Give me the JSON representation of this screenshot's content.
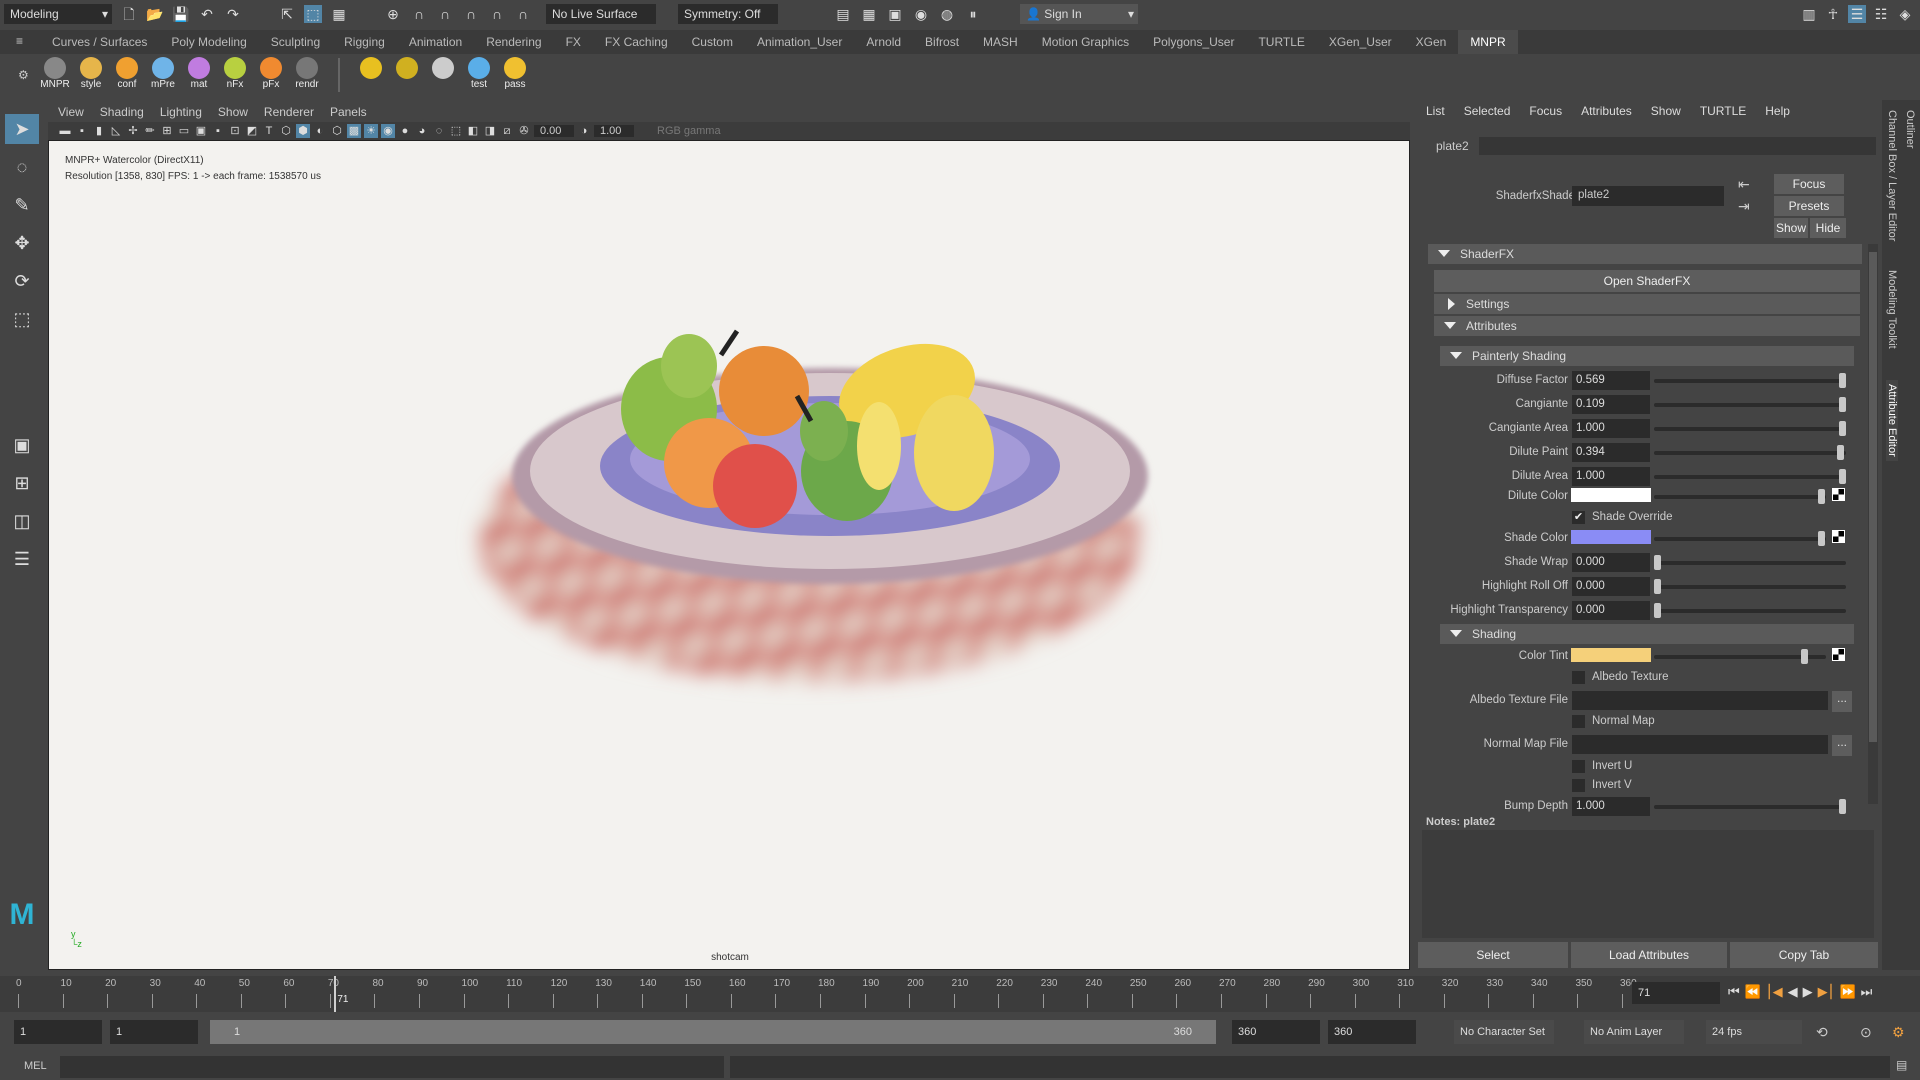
{
  "status_line": {
    "workspace": "Modeling",
    "live_surface": "No Live Surface",
    "symmetry": "Symmetry: Off",
    "sign_in": "Sign In"
  },
  "shelf_tabs": [
    "Curves / Surfaces",
    "Poly Modeling",
    "Sculpting",
    "Rigging",
    "Animation",
    "Rendering",
    "FX",
    "FX Caching",
    "Custom",
    "Animation_User",
    "Arnold",
    "Bifrost",
    "MASH",
    "Motion Graphics",
    "Polygons_User",
    "TURTLE",
    "XGen_User",
    "XGen",
    "MNPR"
  ],
  "active_shelf": "MNPR",
  "shelf_items": [
    {
      "label": "MNPR",
      "color": "#888888"
    },
    {
      "label": "style",
      "color": "#e6b54a"
    },
    {
      "label": "conf",
      "color": "#f0a030"
    },
    {
      "label": "mPre",
      "color": "#6fb4e8"
    },
    {
      "label": "mat",
      "color": "#c07ce0"
    },
    {
      "label": "nFx",
      "color": "#b8d040"
    },
    {
      "label": "pFx",
      "color": "#f08a30"
    },
    {
      "label": "rendr",
      "color": "#777777"
    },
    {
      "label": "",
      "color": "#e8c020"
    },
    {
      "label": "",
      "color": "#d0b020"
    },
    {
      "label": "",
      "color": "#cccccc"
    },
    {
      "label": "test",
      "color": "#5aaee8"
    },
    {
      "label": "pass",
      "color": "#f0c030"
    }
  ],
  "viewport": {
    "menu": [
      "View",
      "Shading",
      "Lighting",
      "Show",
      "Renderer",
      "Panels"
    ],
    "exposure": "0.00",
    "gamma": "1.00",
    "color_space": "RGB gamma",
    "hud_line1": "MNPR+ Watercolor     (DirectX11)",
    "hud_line2": "Resolution [1358, 830]      FPS: 1 -> each frame: 1538570 us",
    "camera": "shotcam"
  },
  "attribute_editor": {
    "menu": [
      "List",
      "Selected",
      "Focus",
      "Attributes",
      "Show",
      "TURTLE",
      "Help"
    ],
    "node_tab": "plate2",
    "shader_label": "ShaderfxShader:",
    "shader_value": "plate2",
    "buttons": {
      "focus": "Focus",
      "presets": "Presets",
      "show": "Show",
      "hide": "Hide"
    },
    "shaderfx_section": "ShaderFX",
    "open_shaderfx": "Open ShaderFX",
    "settings": "Settings",
    "attributes": "Attributes",
    "painterly_section": "Painterly Shading",
    "painterly": [
      {
        "label": "Diffuse Factor",
        "value": "0.569"
      },
      {
        "label": "Cangiante",
        "value": "0.109"
      },
      {
        "label": "Cangiante Area",
        "value": "1.000"
      },
      {
        "label": "Dilute Paint",
        "value": "0.394"
      },
      {
        "label": "Dilute Area",
        "value": "1.000"
      }
    ],
    "dilute_color": {
      "label": "Dilute Color",
      "color": "#ffffff"
    },
    "shade_override": {
      "label": "Shade Override",
      "checked": true
    },
    "shade_color": {
      "label": "Shade Color",
      "color": "#8a8cf5"
    },
    "painterly2": [
      {
        "label": "Shade Wrap",
        "value": "0.000"
      },
      {
        "label": "Highlight Roll Off",
        "value": "0.000"
      },
      {
        "label": "Highlight Transparency",
        "value": "0.000"
      }
    ],
    "shading_section": "Shading",
    "color_tint": {
      "label": "Color Tint",
      "color": "#f5d07a"
    },
    "albedo_texture": "Albedo Texture",
    "albedo_texture_file": "Albedo Texture File",
    "normal_map": "Normal Map",
    "normal_map_file": "Normal Map File",
    "invert_u": "Invert U",
    "invert_v": "Invert V",
    "bump_depth": {
      "label": "Bump Depth",
      "value": "1.000"
    },
    "browse": "...",
    "notes_label": "Notes:  plate2",
    "bottom": {
      "select": "Select",
      "load": "Load Attributes",
      "copy": "Copy Tab"
    }
  },
  "side_tabs": [
    "Outliner",
    "Channel Box / Layer Editor",
    "Modeling Toolkit",
    "Attribute Editor"
  ],
  "timeline": {
    "start": 0,
    "end": 360,
    "step": 10,
    "current_frame": "71",
    "current_value": 71
  },
  "range": {
    "start": "1",
    "anim_start": "1",
    "slider_start": "1",
    "slider_end": "360",
    "anim_end": "360",
    "end": "360",
    "character_set": "No Character Set",
    "anim_layer": "No Anim Layer",
    "fps": "24 fps"
  },
  "command_line": {
    "mode": "MEL"
  }
}
